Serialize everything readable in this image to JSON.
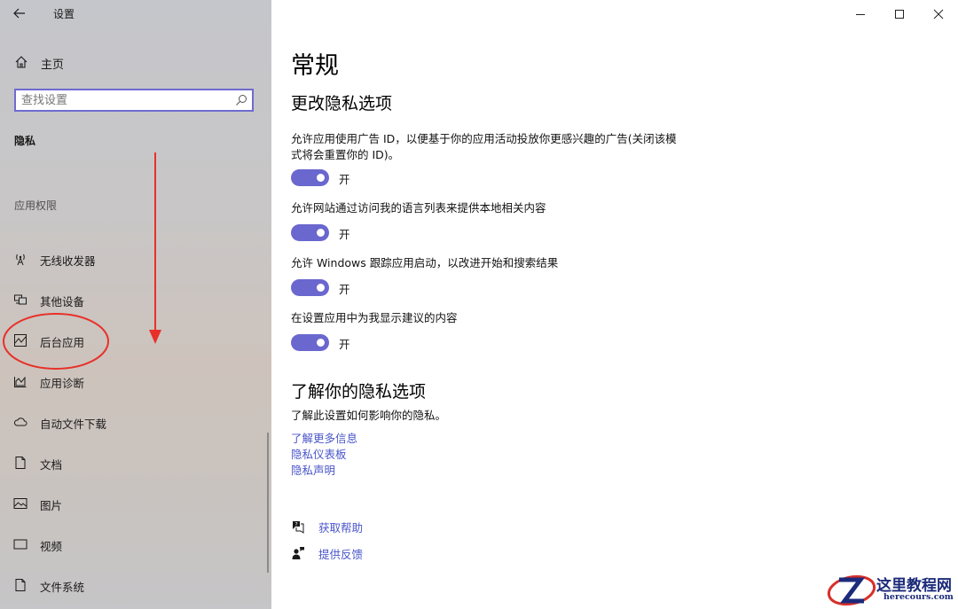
{
  "window": {
    "title": "设置"
  },
  "sidebar": {
    "home_label": "主页",
    "search": {
      "placeholder": "查找设置",
      "value": ""
    },
    "section_heading": "隐私",
    "group_label": "应用权限",
    "items": [
      {
        "label": "无线收发器",
        "icon": "radio-tower-icon"
      },
      {
        "label": "其他设备",
        "icon": "devices-icon"
      },
      {
        "label": "后台应用",
        "icon": "background-apps-icon"
      },
      {
        "label": "应用诊断",
        "icon": "diagnostics-icon"
      },
      {
        "label": "自动文件下载",
        "icon": "cloud-icon"
      },
      {
        "label": "文档",
        "icon": "document-icon"
      },
      {
        "label": "图片",
        "icon": "picture-icon"
      },
      {
        "label": "视频",
        "icon": "video-icon"
      },
      {
        "label": "文件系统",
        "icon": "file-system-icon"
      }
    ]
  },
  "main": {
    "page_title": "常规",
    "section_title": "更改隐私选项",
    "options": [
      {
        "desc": "允许应用使用广告 ID，以便基于你的应用活动投放你更感兴趣的广告(关闭该模式将会重置你的 ID)。",
        "state": "开",
        "on": true
      },
      {
        "desc": "允许网站通过访问我的语言列表来提供本地相关内容",
        "state": "开",
        "on": true
      },
      {
        "desc": "允许 Windows 跟踪应用启动，以改进开始和搜索结果",
        "state": "开",
        "on": true
      },
      {
        "desc": "在设置应用中为我显示建议的内容",
        "state": "开",
        "on": true
      }
    ],
    "learn_title": "了解你的隐私选项",
    "learn_desc": "了解此设置如何影响你的隐私。",
    "links": [
      "了解更多信息",
      "隐私仪表板",
      "隐私声明"
    ],
    "help": [
      {
        "label": "获取帮助",
        "icon": "help-chat-icon"
      },
      {
        "label": "提供反馈",
        "icon": "feedback-icon"
      }
    ]
  },
  "watermark": {
    "name": "这里教程网",
    "url": "herecours.com"
  },
  "colors": {
    "accent": "#6a67cf",
    "link": "#4a56c9",
    "annotation": "#e8302a"
  }
}
